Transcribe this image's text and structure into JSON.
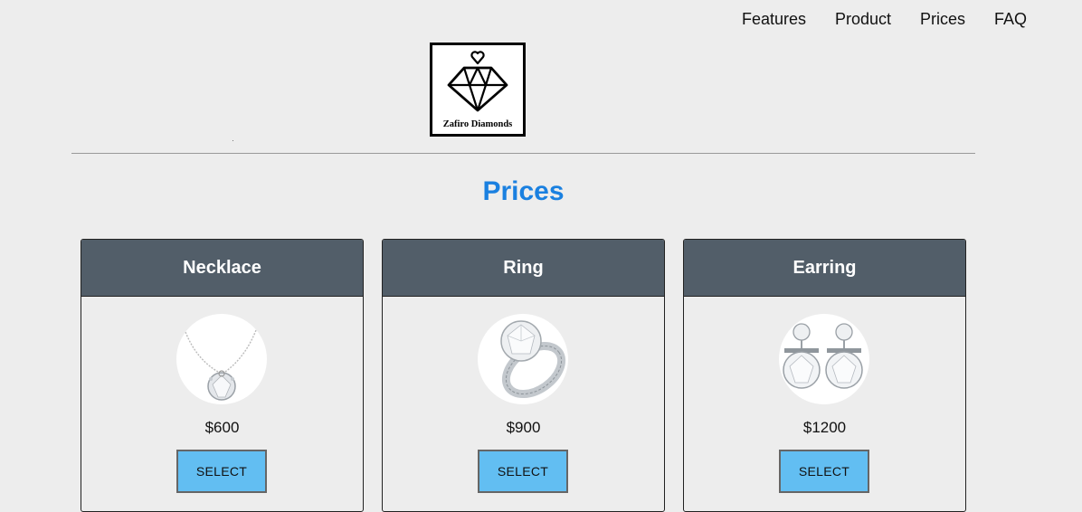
{
  "nav": {
    "items": [
      {
        "label": "Features"
      },
      {
        "label": "Product"
      },
      {
        "label": "Prices"
      },
      {
        "label": "FAQ"
      }
    ]
  },
  "logo": {
    "text": "Zafiro Diamonds",
    "icon": "diamond-heart-icon"
  },
  "section": {
    "title": "Prices"
  },
  "cards": [
    {
      "title": "Necklace",
      "price": "$600",
      "button": "SELECT",
      "image": "necklace-image"
    },
    {
      "title": "Ring",
      "price": "$900",
      "button": "SELECT",
      "image": "ring-image"
    },
    {
      "title": "Earring",
      "price": "$1200",
      "button": "SELECT",
      "image": "earring-image"
    }
  ],
  "colors": {
    "background": "#ededed",
    "title": "#1a80e0",
    "card_header": "#525e69",
    "button": "#62bef2"
  }
}
